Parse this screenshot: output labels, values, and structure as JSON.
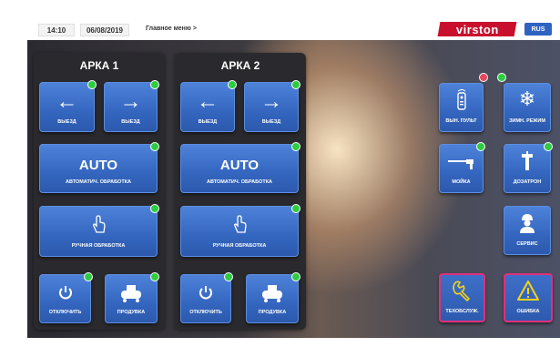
{
  "topbar": {
    "time": "14:10",
    "date": "06/08/2019",
    "breadcrumb": "Главное меню >",
    "brand": "virston",
    "language": "RUS"
  },
  "arches": [
    {
      "title": "АРКА 1",
      "exit_left": {
        "icon": "arrow-left-icon",
        "label": "ВЫЕЗД"
      },
      "exit_right": {
        "icon": "arrow-right-icon",
        "label": "ВЫЕЗД"
      },
      "auto": {
        "title": "AUTO",
        "label": "АВТОМАТИЧ. ОБРАБОТКА"
      },
      "manual": {
        "icon": "hand-pointer-icon",
        "label": "РУЧНАЯ ОБРАБОТКА"
      },
      "power": {
        "icon": "power-icon",
        "label": "ОТКЛЮЧИТЬ"
      },
      "purge": {
        "icon": "compressor-icon",
        "label": "ПРОДУВКА"
      }
    },
    {
      "title": "АРКА 2",
      "exit_left": {
        "icon": "arrow-left-icon",
        "label": "ВЫЕЗД"
      },
      "exit_right": {
        "icon": "arrow-right-icon",
        "label": "ВЫЕЗД"
      },
      "auto": {
        "title": "AUTO",
        "label": "АВТОМАТИЧ. ОБРАБОТКА"
      },
      "manual": {
        "icon": "hand-pointer-icon",
        "label": "РУЧНАЯ ОБРАБОТКА"
      },
      "power": {
        "icon": "power-icon",
        "label": "ОТКЛЮЧИТЬ"
      },
      "purge": {
        "icon": "compressor-icon",
        "label": "ПРОДУВКА"
      }
    }
  ],
  "side": {
    "remote": {
      "icon": "remote-control-icon",
      "label": "ВЫН. ПУЛЬТ"
    },
    "winter": {
      "icon": "snowflake-icon",
      "label": "ЗИМН. РЕЖИМ"
    },
    "wash": {
      "icon": "pressure-washer-icon",
      "label": "МОЙКА"
    },
    "dosing": {
      "icon": "dosing-icon",
      "label": "ДОЗАТРОН"
    },
    "service": {
      "icon": "worker-icon",
      "label": "СЕРВИС"
    },
    "maintenance": {
      "icon": "wrench-icon",
      "label": "ТЕХОБСЛУЖ."
    },
    "error": {
      "icon": "warning-icon",
      "label": "ОШИБКА"
    }
  },
  "colors": {
    "brand": "#c8102e",
    "button": "#3466bf",
    "status_ok": "#2ecc40",
    "status_alert": "#e8485a",
    "warning_border": "#e0307a"
  }
}
